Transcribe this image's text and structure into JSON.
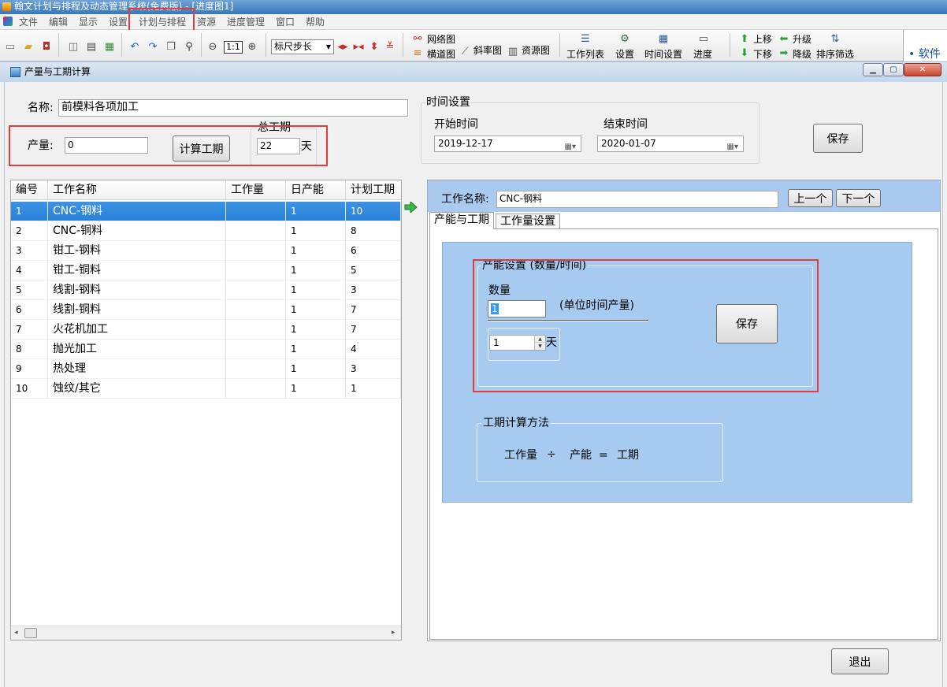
{
  "window_title": "翰文计划与排程及动态管理系统(免费版) - [进度图1]",
  "menu": [
    "文件",
    "编辑",
    "显示",
    "设置",
    "计划与排程",
    "资源",
    "进度管理",
    "窗口",
    "帮助"
  ],
  "toolbar": {
    "zoom_label": "1:1",
    "step_select": "标尺步长",
    "network_label": "网络图",
    "gantt_label": "横道图",
    "slope_label": "斜率图",
    "resource_label": "资源图",
    "task_list_label": "工作列表",
    "settings_label": "设置",
    "time_settings_label": "时间设置",
    "progress_label": "进度",
    "move_up_label": "上移",
    "move_down_label": "下移",
    "promote_label": "升级",
    "demote_label": "降级",
    "sort_filter_label": "排序筛选",
    "side_text": "• 软件"
  },
  "dialog": {
    "title": "产量与工期计算",
    "name_label": "名称:",
    "name_value": "前模料各项加工",
    "output_label": "产量:",
    "output_value": "0",
    "calc_button": "计算工期",
    "total_duration_label": "总工期",
    "total_duration_value": "22",
    "day_unit": "天",
    "time_settings_title": "时间设置",
    "start_label": "开始时间",
    "start_value": "2019-12-17",
    "end_label": "结束时间",
    "end_value": "2020-01-07",
    "save_button": "保存",
    "exit_button": "退出"
  },
  "table": {
    "headers": [
      "编号",
      "工作名称",
      "工作量",
      "日产能",
      "计划工期"
    ],
    "rows": [
      {
        "id": "1",
        "name": "CNC-钢料",
        "work": "",
        "capacity": "1",
        "duration": "10"
      },
      {
        "id": "2",
        "name": "CNC-铜料",
        "work": "",
        "capacity": "1",
        "duration": "8"
      },
      {
        "id": "3",
        "name": "钳工-钢料",
        "work": "",
        "capacity": "1",
        "duration": "6"
      },
      {
        "id": "4",
        "name": "钳工-铜料",
        "work": "",
        "capacity": "1",
        "duration": "5"
      },
      {
        "id": "5",
        "name": "线割-钢料",
        "work": "",
        "capacity": "1",
        "duration": "3"
      },
      {
        "id": "6",
        "name": "线割-铜料",
        "work": "",
        "capacity": "1",
        "duration": "7"
      },
      {
        "id": "7",
        "name": "火花机加工",
        "work": "",
        "capacity": "1",
        "duration": "7"
      },
      {
        "id": "8",
        "name": "抛光加工",
        "work": "",
        "capacity": "1",
        "duration": "4"
      },
      {
        "id": "9",
        "name": "热处理",
        "work": "",
        "capacity": "1",
        "duration": "3"
      },
      {
        "id": "10",
        "name": "蚀纹/其它",
        "work": "",
        "capacity": "1",
        "duration": "1"
      }
    ]
  },
  "detail": {
    "task_name_label": "工作名称:",
    "task_name_value": "CNC-钢料",
    "prev_button": "上一个",
    "next_button": "下一个",
    "tab_capacity": "产能与工期",
    "tab_workload": "工作量设置",
    "capacity_group_title": "产能设置 (数量/时间)",
    "quantity_label": "数量",
    "quantity_value": "1",
    "unit_hint": "(单位时间产量)",
    "time_value": "1",
    "day_unit": "天",
    "save_button": "保存",
    "method_title": "工期计算方法",
    "formula_workload": "工作量",
    "formula_divide": "÷",
    "formula_capacity": "产能",
    "formula_equals": "=",
    "formula_duration": "工期"
  }
}
